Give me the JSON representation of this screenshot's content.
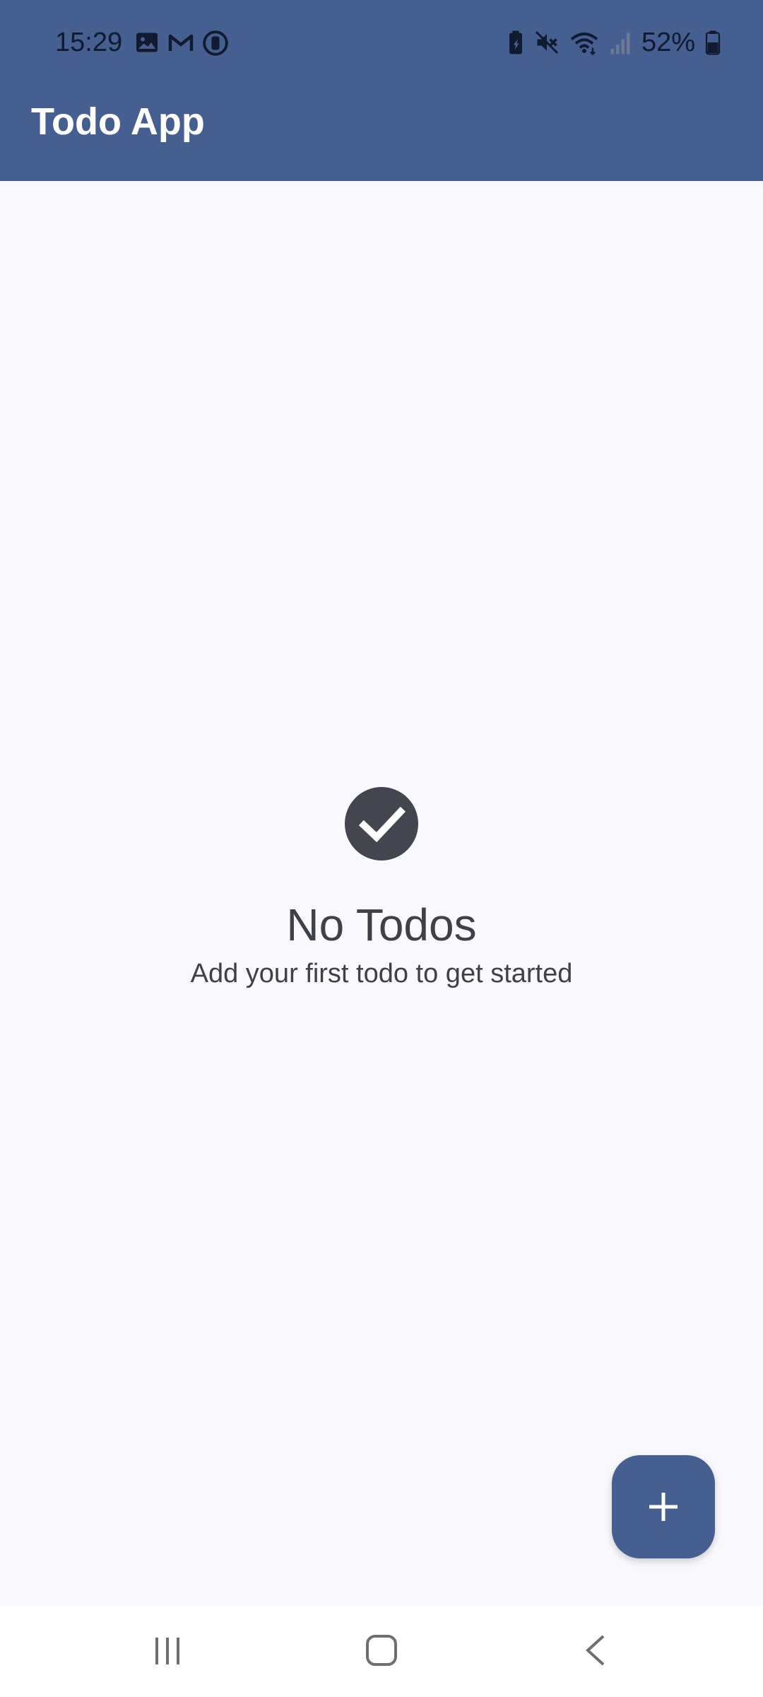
{
  "status_bar": {
    "time": "15:29",
    "battery_percent": "52%",
    "left_icons": [
      "image-icon",
      "gmail-icon",
      "sync-icon"
    ],
    "right_icons": [
      "battery-saver-icon",
      "mute-icon",
      "wifi-icon",
      "signal-icon",
      "battery-icon"
    ]
  },
  "app_bar": {
    "title": "Todo App",
    "color": "#455f91"
  },
  "empty_state": {
    "icon": "check-circle-icon",
    "title": "No Todos",
    "subtitle": "Add your first todo to get started"
  },
  "fab": {
    "icon": "plus-icon"
  },
  "nav_bar": {
    "items": [
      "recents-icon",
      "home-icon",
      "back-icon"
    ]
  }
}
